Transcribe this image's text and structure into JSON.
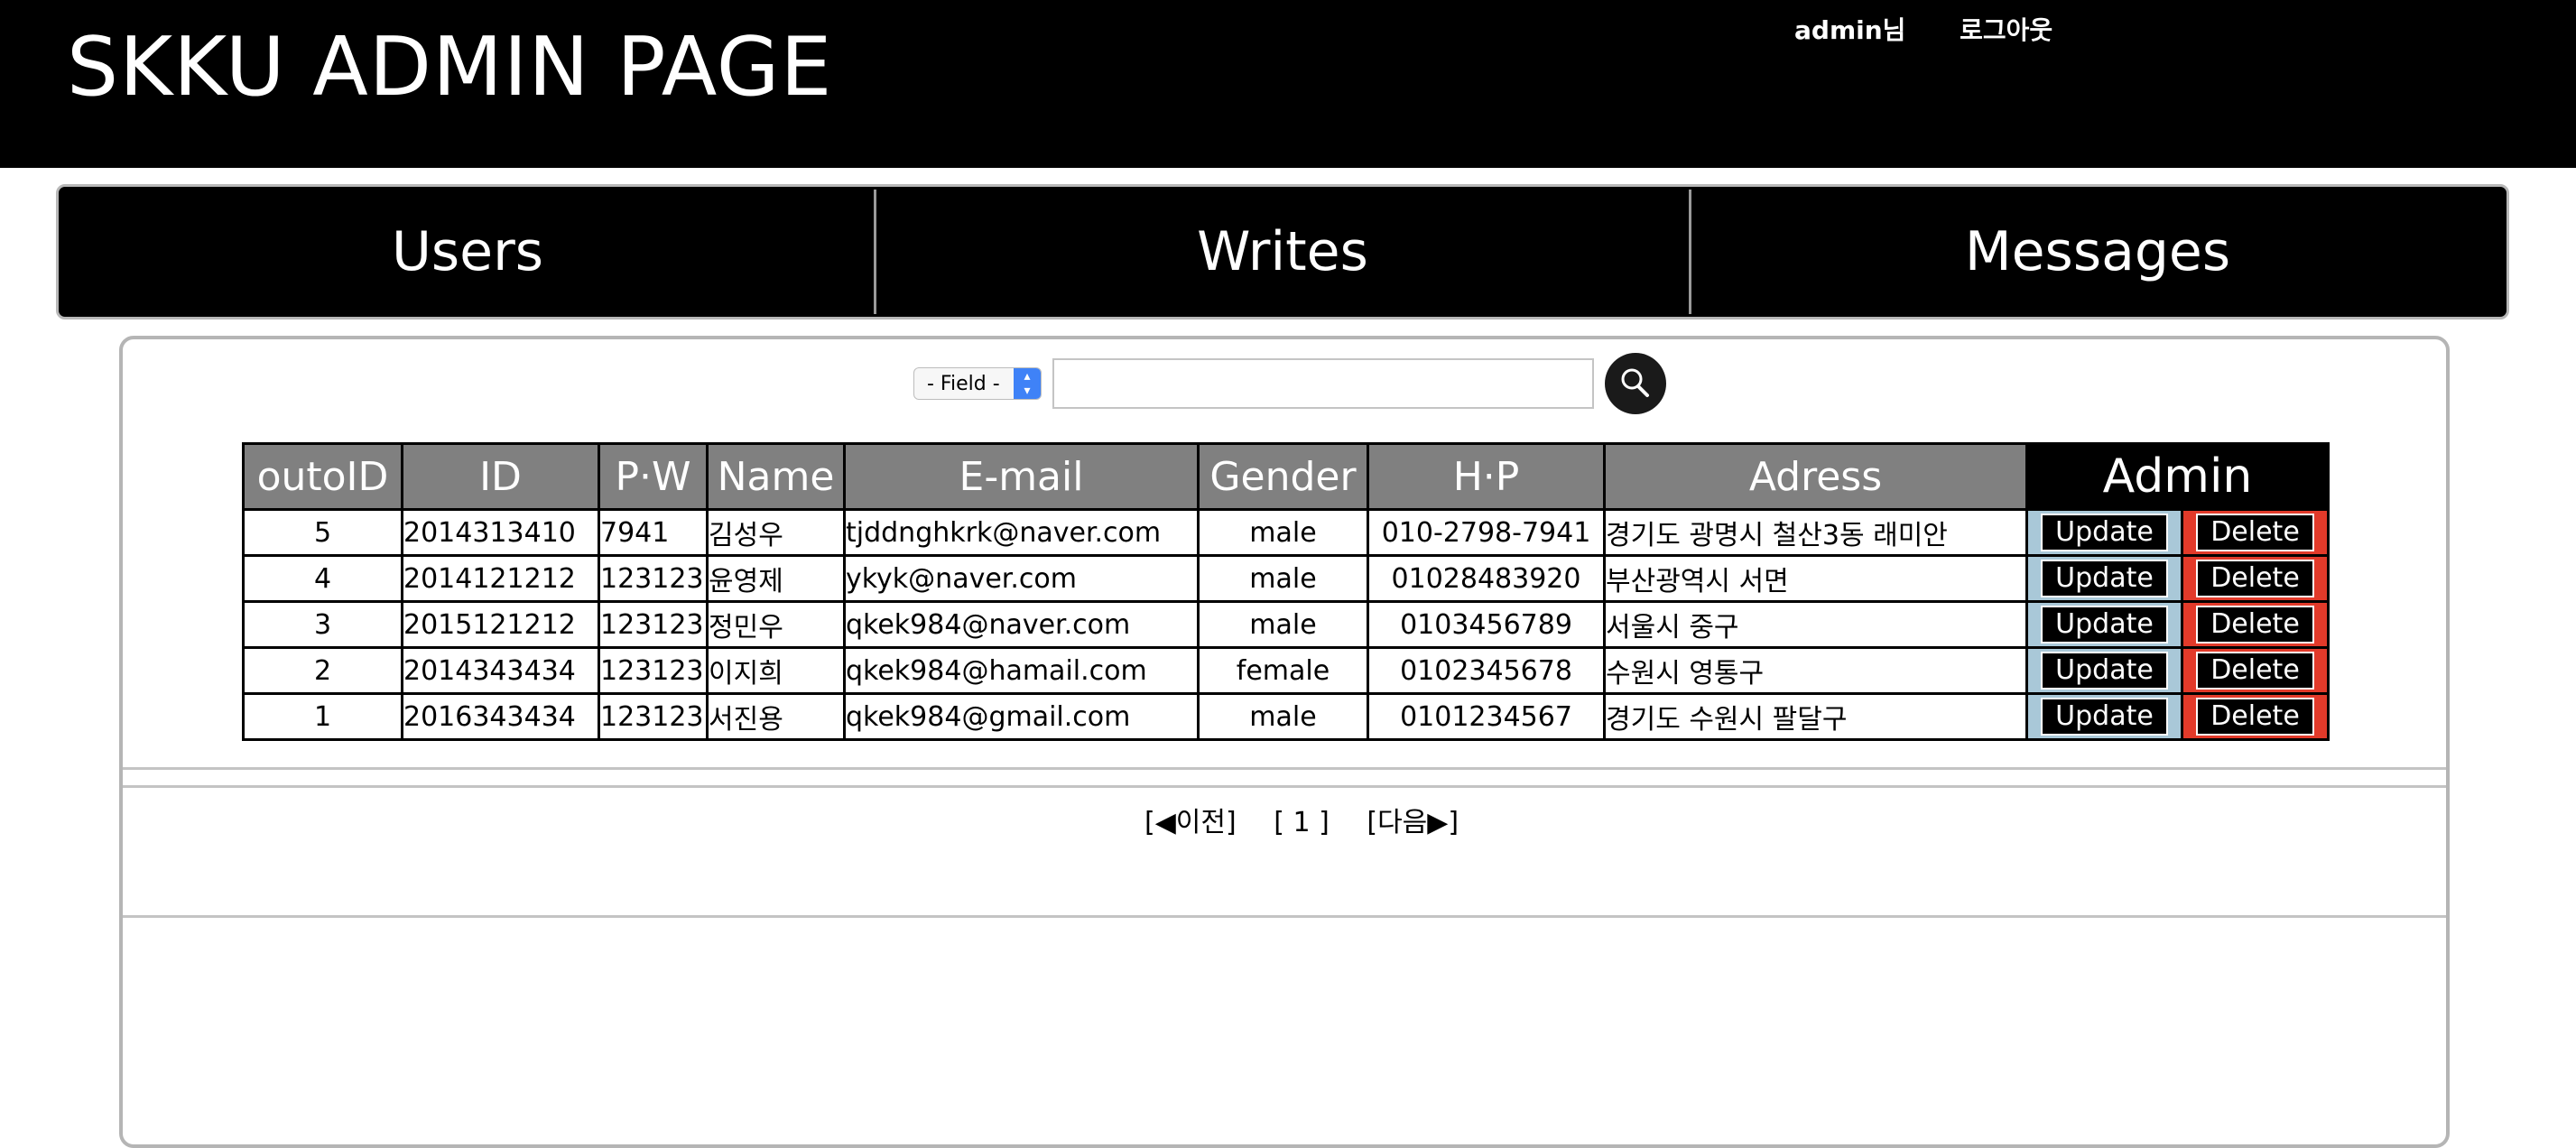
{
  "header": {
    "title": "SKKU ADMIN PAGE",
    "user_label": "admin님",
    "logout_label": "로그아웃"
  },
  "nav": {
    "items": [
      {
        "label": "Users"
      },
      {
        "label": "Writes"
      },
      {
        "label": "Messages"
      }
    ]
  },
  "search": {
    "field_selected": "- Field -",
    "query_value": "",
    "icon": "search-icon"
  },
  "table": {
    "columns": [
      "outoID",
      "ID",
      "P·W",
      "Name",
      "E-mail",
      "Gender",
      "H·P",
      "Adress",
      "Admin"
    ],
    "update_label": "Update",
    "delete_label": "Delete",
    "rows": [
      {
        "outoid": "5",
        "id": "2014313410",
        "pw": "7941",
        "name": "김성우",
        "email": "tjddnghkrk@naver.com",
        "gender": "male",
        "hp": "010-2798-7941",
        "address": "경기도 광명시 철산3동 래미안"
      },
      {
        "outoid": "4",
        "id": "2014121212",
        "pw": "123123",
        "name": "윤영제",
        "email": "ykyk@naver.com",
        "gender": "male",
        "hp": "01028483920",
        "address": "부산광역시 서면"
      },
      {
        "outoid": "3",
        "id": "2015121212",
        "pw": "123123",
        "name": "정민우",
        "email": "qkek984@naver.com",
        "gender": "male",
        "hp": "0103456789",
        "address": "서울시 중구"
      },
      {
        "outoid": "2",
        "id": "2014343434",
        "pw": "123123",
        "name": "이지희",
        "email": "qkek984@hamail.com",
        "gender": "female",
        "hp": "0102345678",
        "address": "수원시 영통구"
      },
      {
        "outoid": "1",
        "id": "2016343434",
        "pw": "123123",
        "name": "서진용",
        "email": "qkek984@gmail.com",
        "gender": "male",
        "hp": "0101234567",
        "address": "경기도 수원시 팔달구"
      }
    ]
  },
  "pager": {
    "prev_label": "[◀이전]",
    "page_label": "[ 1 ]",
    "next_label": "[다음▶]"
  },
  "colors": {
    "header_bg": "#000000",
    "column_header_bg": "#808080",
    "update_cell_bg": "#a9c8d8",
    "delete_cell_bg": "#e23a2a"
  }
}
